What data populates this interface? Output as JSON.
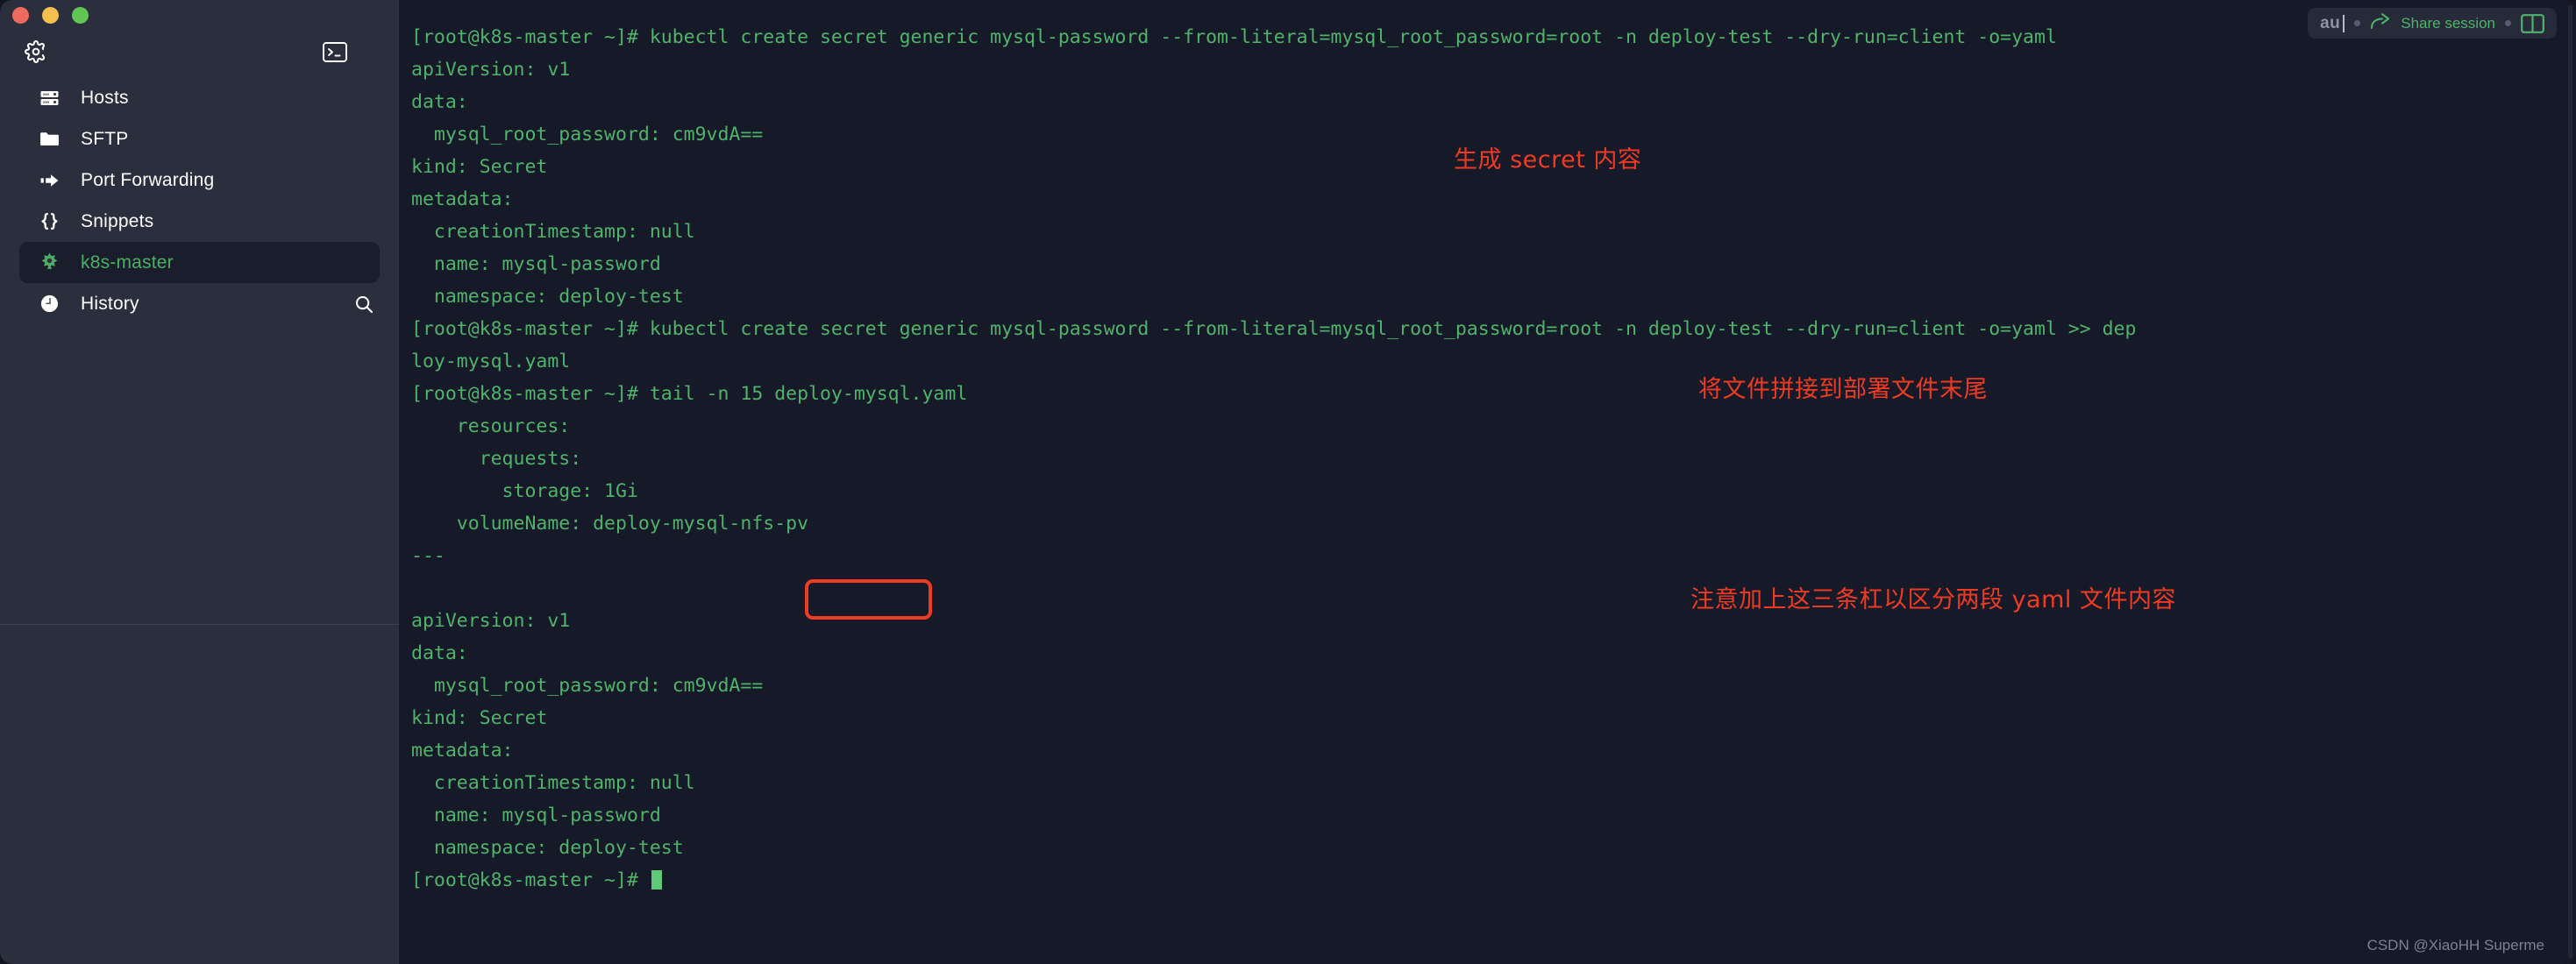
{
  "window": {
    "traffic_lights": [
      "close",
      "minimize",
      "maximize"
    ]
  },
  "sidebar": {
    "top_icons": [
      {
        "name": "settings-gear-icon",
        "label": "Settings"
      },
      {
        "name": "terminal-icon",
        "label": "New terminal"
      }
    ],
    "items": [
      {
        "label": "Hosts",
        "icon": "server-rack-icon",
        "active": false
      },
      {
        "label": "SFTP",
        "icon": "folder-icon",
        "active": false
      },
      {
        "label": "Port Forwarding",
        "icon": "arrow-forward-icon",
        "active": false
      },
      {
        "label": "Snippets",
        "icon": "braces-icon",
        "active": false
      },
      {
        "label": "k8s-master",
        "icon": "kubernetes-icon",
        "active": true
      },
      {
        "label": "History",
        "icon": "clock-icon",
        "active": false,
        "trailing_icon": "search-icon"
      }
    ]
  },
  "toolbar": {
    "session_name": "au",
    "share_label": "Share session",
    "share_icon": "share-arrow-icon",
    "split_icon": "split-pane-icon"
  },
  "terminal": {
    "prompt": "[root@k8s-master ~]#",
    "lines": [
      "[root@k8s-master ~]# kubectl create secret generic mysql-password --from-literal=mysql_root_password=root -n deploy-test --dry-run=client -o=yaml",
      "apiVersion: v1",
      "data:",
      "  mysql_root_password: cm9vdA==",
      "kind: Secret",
      "metadata:",
      "  creationTimestamp: null",
      "  name: mysql-password",
      "  namespace: deploy-test",
      "[root@k8s-master ~]# kubectl create secret generic mysql-password --from-literal=mysql_root_password=root -n deploy-test --dry-run=client -o=yaml >> dep",
      "loy-mysql.yaml",
      "[root@k8s-master ~]# tail -n 15 deploy-mysql.yaml",
      "    resources:",
      "      requests:",
      "        storage: 1Gi",
      "    volumeName: deploy-mysql-nfs-pv",
      "---",
      "",
      "apiVersion: v1",
      "data:",
      "  mysql_root_password: cm9vdA==",
      "kind: Secret",
      "metadata:",
      "  creationTimestamp: null",
      "  name: mysql-password",
      "  namespace: deploy-test",
      "[root@k8s-master ~]# "
    ]
  },
  "annotations": [
    {
      "id": "anno-1",
      "text": "生成 secret 内容"
    },
    {
      "id": "anno-2",
      "text": "将文件拼接到部署文件末尾"
    },
    {
      "id": "anno-3",
      "text": "注意加上这三条杠以区分两段 yaml 文件内容"
    }
  ],
  "watermark": {
    "text": "CSDN @XiaoHH Superme"
  },
  "colors": {
    "terminal_bg": "#161927",
    "sidebar_bg": "#2a2e3d",
    "terminal_green": "#4fb36b",
    "accent_green": "#4cae63",
    "annotation_red": "#ef3b23",
    "active_item_bg": "#1a1d2b"
  }
}
